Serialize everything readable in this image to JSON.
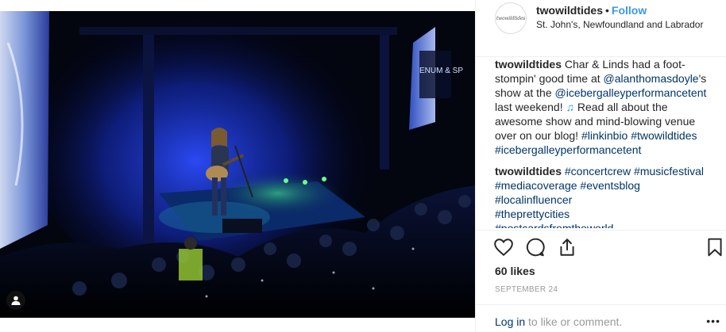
{
  "post": {
    "username": "twowildtides",
    "separator": "•",
    "follow_label": "Follow",
    "location": "St. John's, Newfoundland and Labrador",
    "avatar_text": "twowildtides"
  },
  "caption": {
    "username": "twowildtides",
    "t1": " Char & Linds had a foot-stompin' good time at ",
    "mention1": "@alanthomasdoyle",
    "t2": "'s show at the ",
    "mention2": "@icebergalleyperformancetent",
    "t3": " last weekend! ",
    "emoji": "♫",
    "t4": " Read all about the awesome show and mind-blowing venue over on our blog! ",
    "tag1": "#linkinbio",
    "tag2": "#twowildtides",
    "tag3": "#icebergalleyperformancetent"
  },
  "comment2": {
    "username": "twowildtides",
    "tags": [
      "#concertcrew",
      "#musicfestival",
      "#mediacoverage",
      "#eventsblog",
      "#localinfluencer",
      "#theprettycities",
      "#postcardsfromtheworld"
    ]
  },
  "likes": "60 likes",
  "date": "SEPTEMBER 24",
  "footer": {
    "login_link": "Log in",
    "login_rest": " to like or comment.",
    "more": "•••"
  },
  "photo": {
    "screen_text": "ENUM & SP"
  },
  "colors": {
    "accent": "#3897f0",
    "link": "#003569",
    "stage_blue": "#1a3cff"
  }
}
